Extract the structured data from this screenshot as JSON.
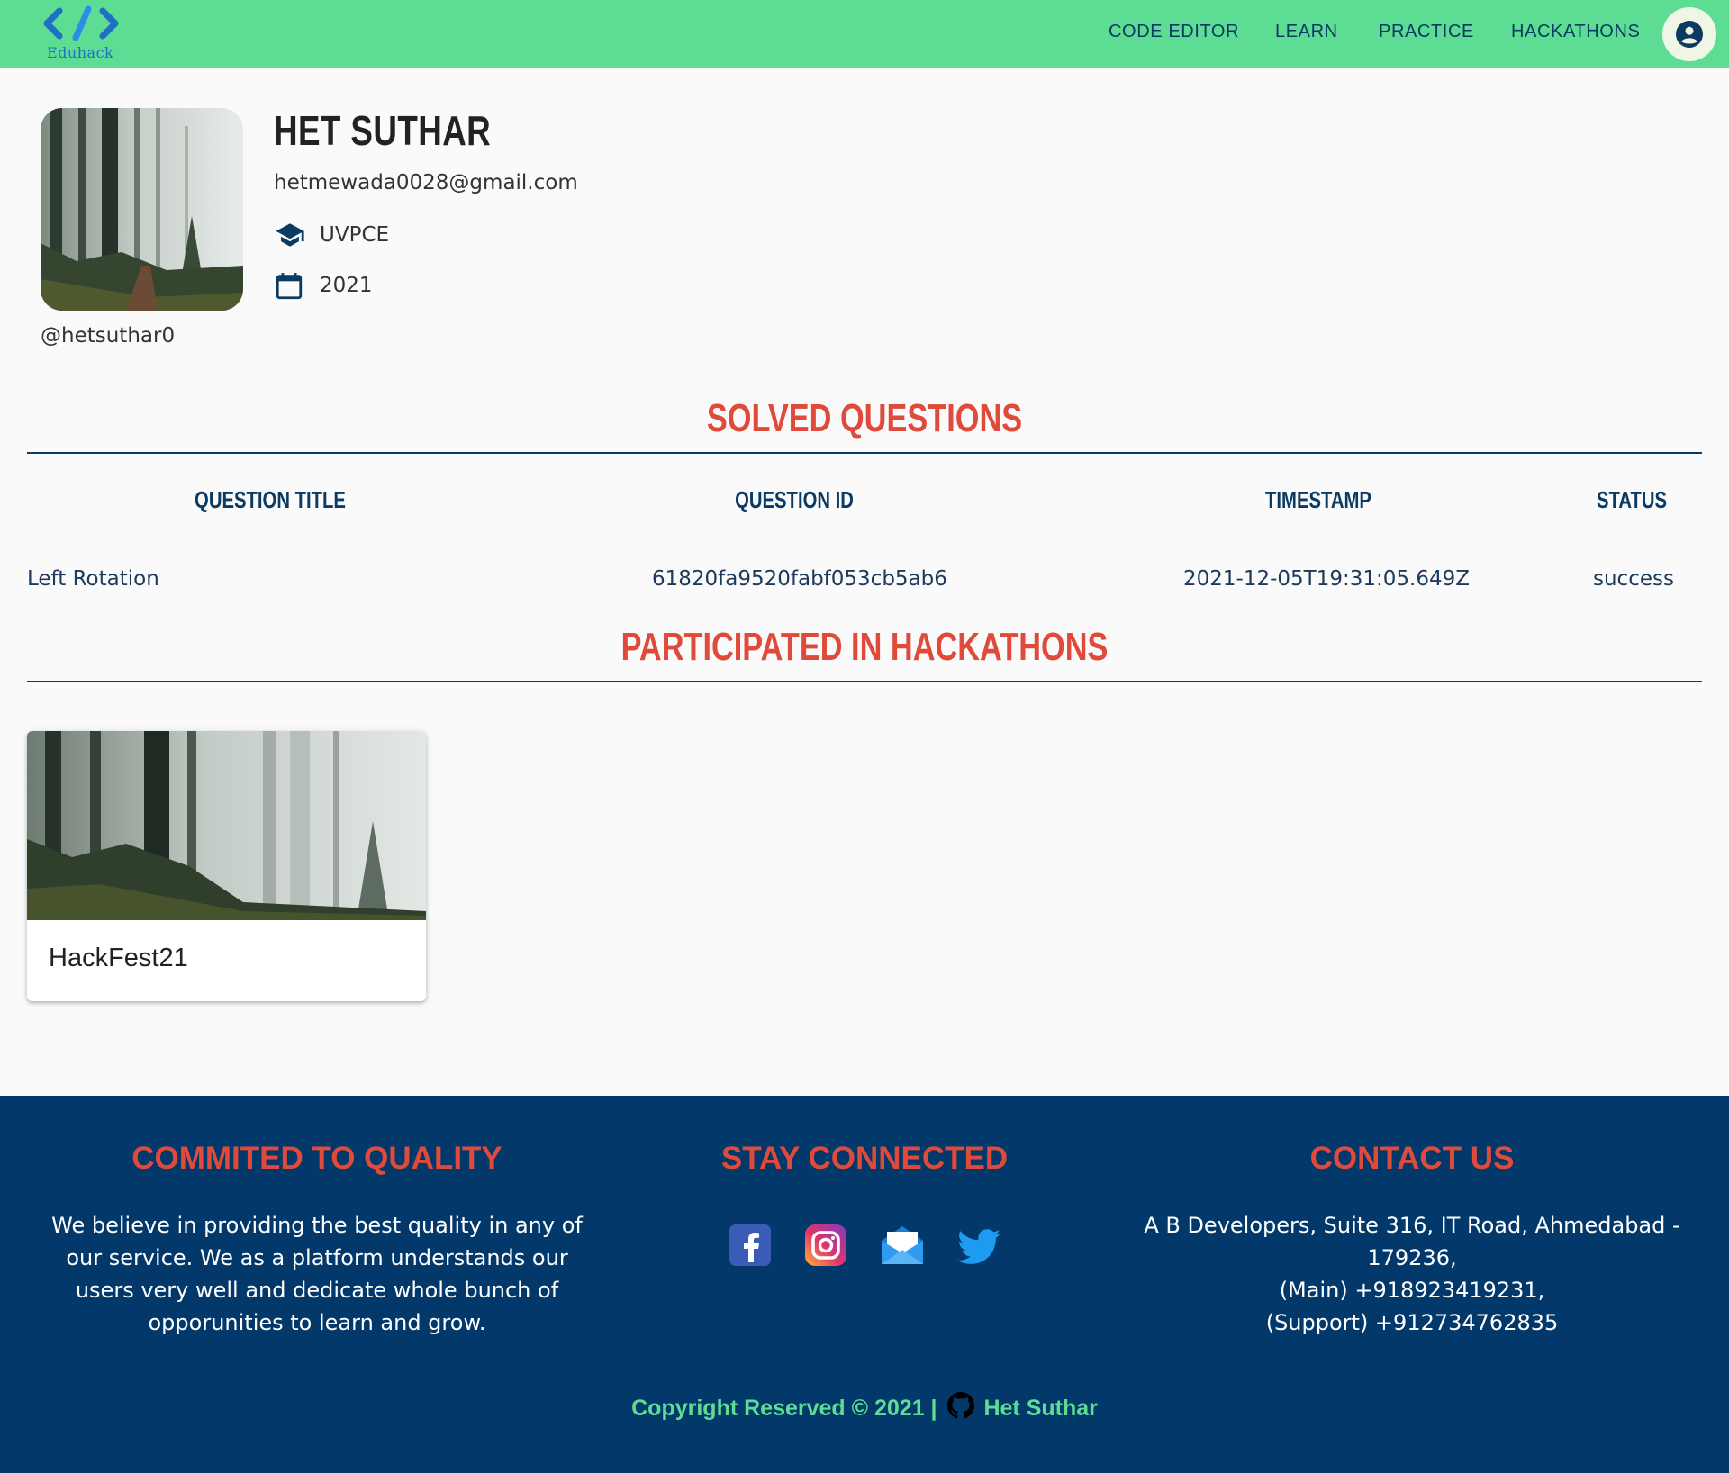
{
  "brand": {
    "logo_text": "Eduhack",
    "colors": {
      "nav_bg": "#5ddd94",
      "accent_red": "#e04a3b",
      "navy": "#03386b"
    }
  },
  "nav": {
    "links": [
      {
        "label": "CODE EDITOR"
      },
      {
        "label": "LEARN"
      },
      {
        "label": "PRACTICE"
      },
      {
        "label": "HACKATHONS"
      }
    ],
    "account_icon": "account-circle-icon"
  },
  "profile": {
    "name": "HET SUTHAR",
    "email": "hetmewada0028@gmail.com",
    "college": "UVPCE",
    "year": "2021",
    "handle": "@hetsuthar0",
    "college_icon": "graduation-cap-icon",
    "year_icon": "calendar-icon"
  },
  "solved": {
    "title": "SOLVED QUESTIONS",
    "columns": [
      "QUESTION TITLE",
      "QUESTION ID",
      "TIMESTAMP",
      "STATUS"
    ],
    "rows": [
      {
        "title": "Left Rotation",
        "id": "61820fa9520fabf053cb5ab6",
        "timestamp": "2021-12-05T19:31:05.649Z",
        "status": "success"
      }
    ]
  },
  "hackathons": {
    "title": "PARTICIPATED IN HACKATHONS",
    "cards": [
      {
        "name": "HackFest21"
      }
    ]
  },
  "footer": {
    "quality": {
      "title": "COMMITED TO QUALITY",
      "lines": [
        "We believe in providing the best quality in any of",
        "our service. We as a platform understands our",
        "users very well and dedicate whole bunch of",
        "opporunities to learn and grow."
      ]
    },
    "connect": {
      "title": "STAY CONNECTED",
      "icons": [
        "facebook-icon",
        "instagram-icon",
        "mail-icon",
        "twitter-icon"
      ]
    },
    "contact": {
      "title": "CONTACT US",
      "lines": [
        "A B Developers, Suite 316, IT Road, Ahmedabad -",
        "179236,",
        "(Main) +918923419231,",
        "(Support) +912734762835"
      ]
    },
    "copyright": {
      "text": "Copyright Reserved © 2021 |",
      "author": "Het Suthar",
      "icon": "github-icon"
    }
  }
}
